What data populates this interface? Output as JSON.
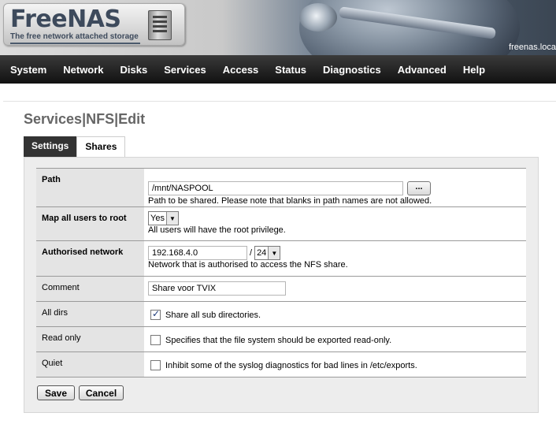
{
  "header": {
    "logo_name": "FreeNAS",
    "logo_tagline": "The free network attached storage",
    "hostname": "freenas.loca"
  },
  "nav": {
    "items": [
      "System",
      "Network",
      "Disks",
      "Services",
      "Access",
      "Status",
      "Diagnostics",
      "Advanced",
      "Help"
    ]
  },
  "breadcrumb": {
    "title": "Services|NFS|Edit"
  },
  "tabs": [
    {
      "label": "Settings",
      "active": true
    },
    {
      "label": "Shares",
      "active": false
    }
  ],
  "form": {
    "path": {
      "label": "Path",
      "value": "/mnt/NASPOOL",
      "browse_label": "...",
      "hint": "Path to be shared. Please note that blanks in path names are not allowed."
    },
    "mapall": {
      "label": "Map all users to root",
      "selected": "Yes",
      "hint": "All users will have the root privilege."
    },
    "network": {
      "label": "Authorised network",
      "address": "192.168.4.0",
      "separator": "/",
      "mask": "24",
      "hint": "Network that is authorised to access the NFS share."
    },
    "comment": {
      "label": "Comment",
      "value": "Share voor TVIX"
    },
    "alldirs": {
      "label": "All dirs",
      "checked": true,
      "text": "Share all sub directories."
    },
    "readonly": {
      "label": "Read only",
      "checked": false,
      "text": "Specifies that the file system should be exported read-only."
    },
    "quiet": {
      "label": "Quiet",
      "checked": false,
      "text": "Inhibit some of the syslog diagnostics for bad lines in /etc/exports."
    }
  },
  "buttons": {
    "save": "Save",
    "cancel": "Cancel"
  },
  "colors": {
    "nav_bg": "#1a1a1a",
    "tab_active_bg": "#333333",
    "label_bg": "#e4e4e4",
    "panel_bg": "#ededed",
    "title_color": "#666666"
  }
}
